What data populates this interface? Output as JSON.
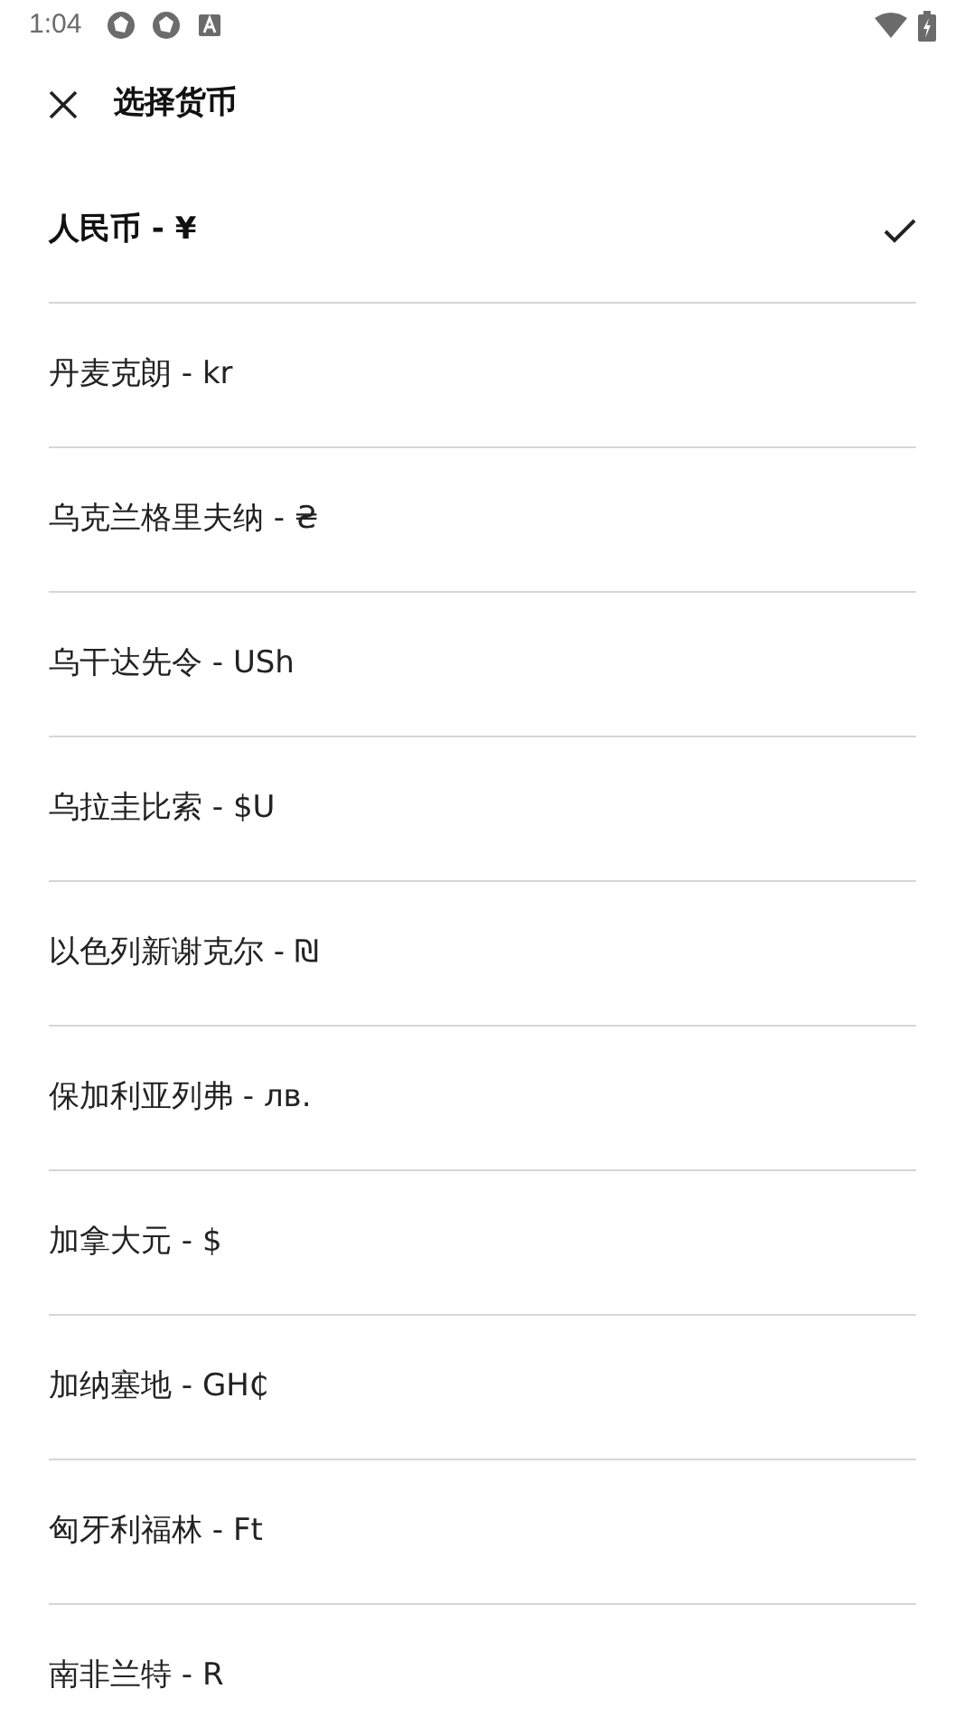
{
  "status_bar": {
    "time": "1:04"
  },
  "header": {
    "title": "选择货币"
  },
  "currencies": [
    {
      "label": "人民币 - ¥",
      "selected": true
    },
    {
      "label": "丹麦克朗 - kr",
      "selected": false
    },
    {
      "label": "乌克兰格里夫纳 - ₴",
      "selected": false
    },
    {
      "label": "乌干达先令 - USh",
      "selected": false
    },
    {
      "label": "乌拉圭比索 - $U",
      "selected": false
    },
    {
      "label": "以色列新谢克尔 - ₪",
      "selected": false
    },
    {
      "label": "保加利亚列弗 - лв.",
      "selected": false
    },
    {
      "label": "加拿大元 - $",
      "selected": false
    },
    {
      "label": "加纳塞地 - GH₵",
      "selected": false
    },
    {
      "label": "匈牙利福林 - Ft",
      "selected": false
    },
    {
      "label": "南非兰特 - R",
      "selected": false
    }
  ]
}
